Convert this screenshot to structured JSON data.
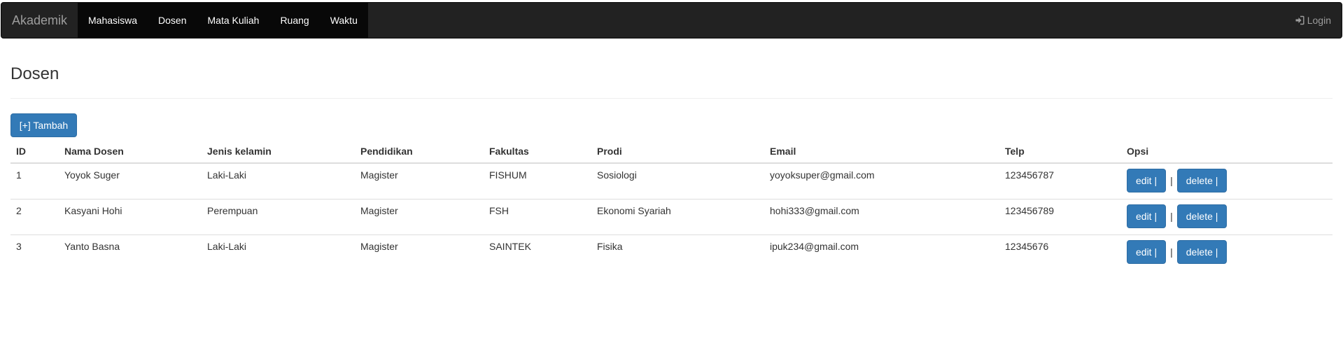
{
  "navbar": {
    "brand": "Akademik",
    "items": [
      {
        "label": "Mahasiswa"
      },
      {
        "label": "Dosen"
      },
      {
        "label": "Mata Kuliah"
      },
      {
        "label": "Ruang"
      },
      {
        "label": "Waktu"
      }
    ],
    "login_label": "Login"
  },
  "page": {
    "title": "Dosen",
    "add_button": "[+] Tambah"
  },
  "table": {
    "headers": [
      "ID",
      "Nama Dosen",
      "Jenis kelamin",
      "Pendidikan",
      "Fakultas",
      "Prodi",
      "Email",
      "Telp",
      "Opsi"
    ],
    "rows": [
      {
        "id": "1",
        "nama": "Yoyok Suger",
        "jk": "Laki-Laki",
        "pendidikan": "Magister",
        "fakultas": "FISHUM",
        "prodi": "Sosiologi",
        "email": "yoyoksuper@gmail.com",
        "telp": "123456787"
      },
      {
        "id": "2",
        "nama": "Kasyani Hohi",
        "jk": "Perempuan",
        "pendidikan": "Magister",
        "fakultas": "FSH",
        "prodi": "Ekonomi Syariah",
        "email": "hohi333@gmail.com",
        "telp": "123456789"
      },
      {
        "id": "3",
        "nama": "Yanto Basna",
        "jk": "Laki-Laki",
        "pendidikan": "Magister",
        "fakultas": "SAINTEK",
        "prodi": "Fisika",
        "email": "ipuk234@gmail.com",
        "telp": "12345676"
      }
    ],
    "edit_label": "edit |",
    "separator": "|",
    "delete_label": "delete |"
  },
  "colors": {
    "navbar_bg": "#222222",
    "nav_active_bg": "#080808",
    "primary": "#337ab7"
  },
  "icons": {
    "login": "login-icon"
  }
}
